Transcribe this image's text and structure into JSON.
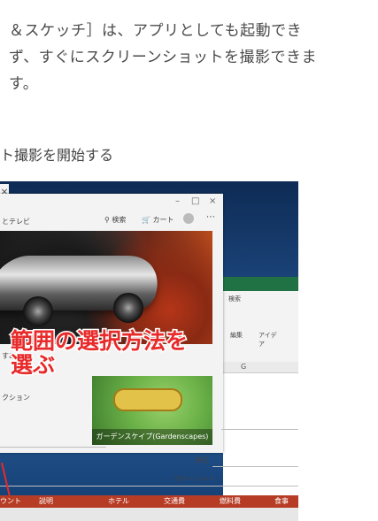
{
  "article": {
    "paragraph_lines": [
      "＆スケッチ］は、アプリとしても起動でき",
      "ず、すぐにスクリーンショットを撮影できま",
      "す。"
    ],
    "step_caption": "ト撮影を開始する"
  },
  "screenshot": {
    "close_glyph": "×",
    "store": {
      "nav_left": "とテレビ",
      "search_label": "検索",
      "cart_label": "カート",
      "more_glyph": "⋯",
      "sidebar_label_1": "すめ",
      "sidebar_label_2": "クション",
      "game_caption": "ガーデンスケイプ(Gardenscapes)"
    },
    "excel": {
      "ribbon_tab": "検索",
      "edit_label": "編集",
      "idea_label": "アイデア",
      "column_label": "G"
    },
    "sheet": {
      "label_1": "単位",
      "label_2": "マネージャー:"
    },
    "bottom_band": [
      "ウント",
      "説明",
      "ホテル",
      "交通費",
      "燃料費",
      "食事"
    ]
  },
  "annotation": {
    "lines": [
      "範囲の選択方法を",
      "選ぶ"
    ],
    "color": "#e82a2a"
  }
}
